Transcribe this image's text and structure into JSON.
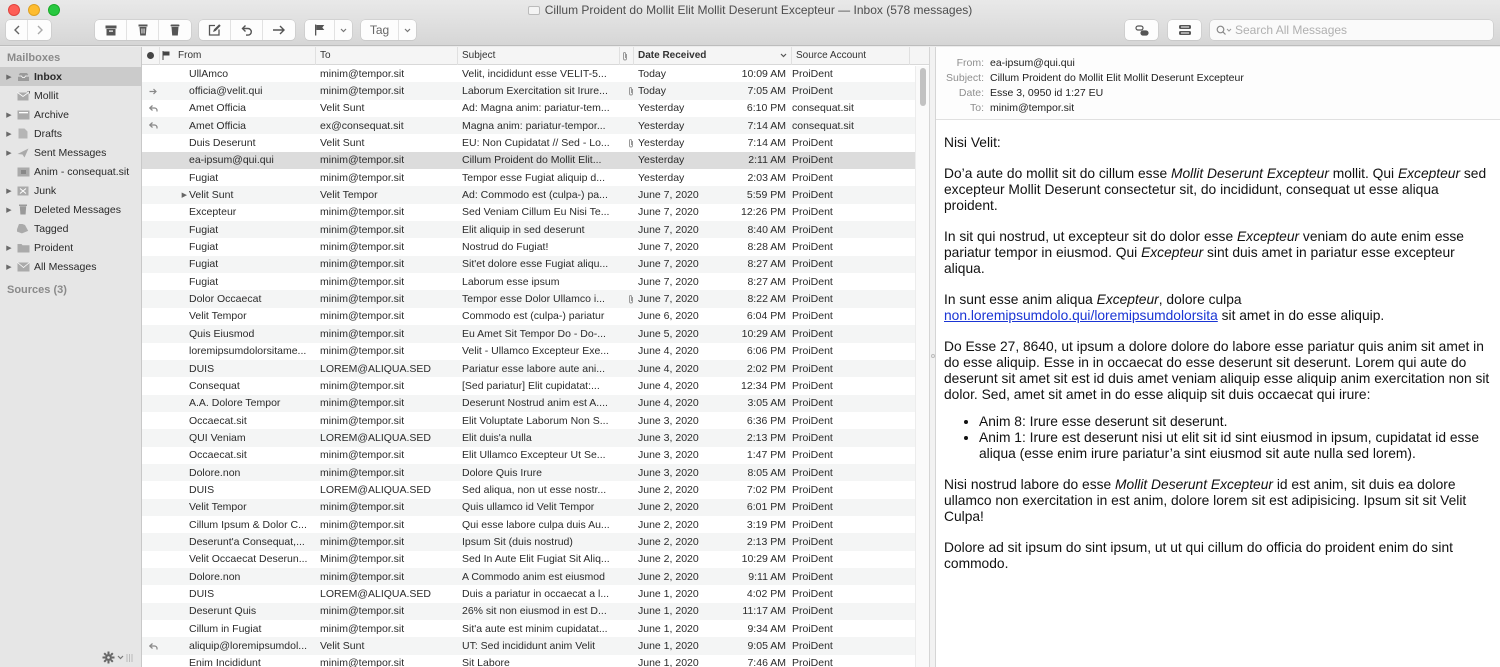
{
  "window": {
    "title": "Cillum Proident do Mollit Elit Mollit Deserunt Excepteur — Inbox (578 messages)"
  },
  "toolbar": {
    "tag_label": "Tag",
    "search_placeholder": "Search All Messages",
    "search_value": ""
  },
  "sidebar": {
    "header": "Mailboxes",
    "items": [
      {
        "label": "Inbox",
        "icon": "inbox-icon",
        "disclosure": true,
        "selected": true
      },
      {
        "label": "Mollit",
        "icon": "vip-mail-icon",
        "disclosure": false
      },
      {
        "label": "Archive",
        "icon": "archive-icon",
        "disclosure": true
      },
      {
        "label": "Drafts",
        "icon": "drafts-icon",
        "disclosure": true
      },
      {
        "label": "Sent Messages",
        "icon": "sent-icon",
        "disclosure": true
      },
      {
        "label": "Anim - consequat.sit",
        "icon": "mailbox-icon",
        "disclosure": false
      },
      {
        "label": "Junk",
        "icon": "junk-icon",
        "disclosure": true
      },
      {
        "label": "Deleted Messages",
        "icon": "trash-icon",
        "disclosure": true
      },
      {
        "label": "Tagged",
        "icon": "tag-icon",
        "disclosure": false
      },
      {
        "label": "Proident",
        "icon": "folder-icon",
        "disclosure": true
      },
      {
        "label": "All Messages",
        "icon": "all-mail-icon",
        "disclosure": true
      }
    ],
    "sources_label": "Sources (3)"
  },
  "message_list": {
    "columns": {
      "from": "From",
      "to": "To",
      "subject": "Subject",
      "date": "Date Received",
      "source": "Source Account"
    },
    "rows": [
      {
        "status": "",
        "thread": false,
        "from": "UllAmco",
        "to": "minim@tempor.sit",
        "subject": "Velit, incididunt esse VELIT-5...",
        "attach": false,
        "date": "Today",
        "time": "10:09 AM",
        "source": "ProiDent"
      },
      {
        "status": "forwarded",
        "thread": false,
        "from": "officia@velit.qui",
        "to": "minim@tempor.sit",
        "subject": "Laborum Exercitation sit Irure...",
        "attach": true,
        "date": "Today",
        "time": "7:05 AM",
        "source": "ProiDent"
      },
      {
        "status": "replied",
        "thread": false,
        "from": "Amet Officia",
        "to": "Velit Sunt",
        "subject": "Ad: Magna anim: pariatur-tem...",
        "attach": false,
        "date": "Yesterday",
        "time": "6:10 PM",
        "source": "consequat.sit"
      },
      {
        "status": "replied",
        "thread": false,
        "from": "Amet Officia",
        "to": "ex@consequat.sit",
        "subject": "Magna anim: pariatur-tempor...",
        "attach": false,
        "date": "Yesterday",
        "time": "7:14 AM",
        "source": "consequat.sit"
      },
      {
        "status": "",
        "thread": false,
        "from": "Duis Deserunt",
        "to": "Velit Sunt",
        "subject": "EU: Non Cupidatat // Sed - Lo...",
        "attach": true,
        "date": "Yesterday",
        "time": "7:14 AM",
        "source": "ProiDent"
      },
      {
        "status": "",
        "thread": false,
        "from": "ea-ipsum@qui.qui",
        "to": "minim@tempor.sit",
        "subject": "Cillum Proident do Mollit Elit...",
        "attach": false,
        "date": "Yesterday",
        "time": "2:11 AM",
        "source": "ProiDent",
        "selected": true
      },
      {
        "status": "",
        "thread": false,
        "from": "Fugiat",
        "to": "minim@tempor.sit",
        "subject": "Tempor esse Fugiat aliquip d...",
        "attach": false,
        "date": "Yesterday",
        "time": "2:03 AM",
        "source": "ProiDent"
      },
      {
        "status": "",
        "thread": true,
        "from": "Velit Sunt",
        "to": "Velit Tempor",
        "subject": "Ad: Commodo est (culpa-) pa...",
        "attach": false,
        "date": "June 7, 2020",
        "time": "5:59 PM",
        "source": "ProiDent"
      },
      {
        "status": "",
        "thread": false,
        "from": "Excepteur",
        "to": "minim@tempor.sit",
        "subject": "Sed Veniam Cillum Eu Nisi Te...",
        "attach": false,
        "date": "June 7, 2020",
        "time": "12:26 PM",
        "source": "ProiDent"
      },
      {
        "status": "",
        "thread": false,
        "from": "Fugiat",
        "to": "minim@tempor.sit",
        "subject": "Elit aliquip in sed deserunt",
        "attach": false,
        "date": "June 7, 2020",
        "time": "8:40 AM",
        "source": "ProiDent"
      },
      {
        "status": "",
        "thread": false,
        "from": "Fugiat",
        "to": "minim@tempor.sit",
        "subject": "Nostrud do Fugiat!",
        "attach": false,
        "date": "June 7, 2020",
        "time": "8:28 AM",
        "source": "ProiDent"
      },
      {
        "status": "",
        "thread": false,
        "from": "Fugiat",
        "to": "minim@tempor.sit",
        "subject": "Sit'et dolore esse Fugiat aliqu...",
        "attach": false,
        "date": "June 7, 2020",
        "time": "8:27 AM",
        "source": "ProiDent"
      },
      {
        "status": "",
        "thread": false,
        "from": "Fugiat",
        "to": "minim@tempor.sit",
        "subject": "Laborum esse ipsum",
        "attach": false,
        "date": "June 7, 2020",
        "time": "8:27 AM",
        "source": "ProiDent"
      },
      {
        "status": "",
        "thread": false,
        "from": "Dolor Occaecat",
        "to": "minim@tempor.sit",
        "subject": "Tempor esse Dolor Ullamco i...",
        "attach": true,
        "date": "June 7, 2020",
        "time": "8:22 AM",
        "source": "ProiDent"
      },
      {
        "status": "",
        "thread": false,
        "from": "Velit Tempor",
        "to": "minim@tempor.sit",
        "subject": "Commodo est (culpa-) pariatur",
        "attach": false,
        "date": "June 6, 2020",
        "time": "6:04 PM",
        "source": "ProiDent"
      },
      {
        "status": "",
        "thread": false,
        "from": "Quis Eiusmod",
        "to": "minim@tempor.sit",
        "subject": "Eu Amet Sit Tempor Do - Do-...",
        "attach": false,
        "date": "June 5, 2020",
        "time": "10:29 AM",
        "source": "ProiDent"
      },
      {
        "status": "",
        "thread": false,
        "from": "loremipsumdolorsitame...",
        "to": "minim@tempor.sit",
        "subject": "Velit - Ullamco Excepteur Exe...",
        "attach": false,
        "date": "June 4, 2020",
        "time": "6:06 PM",
        "source": "ProiDent"
      },
      {
        "status": "",
        "thread": false,
        "from": "DUIS",
        "to": "LOREM@ALIQUA.SED",
        "subject": "Pariatur esse labore aute ani...",
        "attach": false,
        "date": "June 4, 2020",
        "time": "2:02 PM",
        "source": "ProiDent"
      },
      {
        "status": "",
        "thread": false,
        "from": "Consequat",
        "to": "minim@tempor.sit",
        "subject": "[Sed pariatur] Elit cupidatat:...",
        "attach": false,
        "date": "June 4, 2020",
        "time": "12:34 PM",
        "source": "ProiDent"
      },
      {
        "status": "",
        "thread": false,
        "from": "A.A. Dolore Tempor",
        "to": "minim@tempor.sit",
        "subject": "Deserunt Nostrud anim est A....",
        "attach": false,
        "date": "June 4, 2020",
        "time": "3:05 AM",
        "source": "ProiDent"
      },
      {
        "status": "",
        "thread": false,
        "from": "Occaecat.sit",
        "to": "minim@tempor.sit",
        "subject": "Elit Voluptate Laborum Non S...",
        "attach": false,
        "date": "June 3, 2020",
        "time": "6:36 PM",
        "source": "ProiDent"
      },
      {
        "status": "",
        "thread": false,
        "from": "QUI Veniam",
        "to": "LOREM@ALIQUA.SED",
        "subject": "Elit duis'a nulla",
        "attach": false,
        "date": "June 3, 2020",
        "time": "2:13 PM",
        "source": "ProiDent"
      },
      {
        "status": "",
        "thread": false,
        "from": "Occaecat.sit",
        "to": "minim@tempor.sit",
        "subject": "Elit Ullamco Excepteur Ut Se...",
        "attach": false,
        "date": "June 3, 2020",
        "time": "1:47 PM",
        "source": "ProiDent"
      },
      {
        "status": "",
        "thread": false,
        "from": "Dolore.non",
        "to": "minim@tempor.sit",
        "subject": "Dolore Quis Irure",
        "attach": false,
        "date": "June 3, 2020",
        "time": "8:05 AM",
        "source": "ProiDent"
      },
      {
        "status": "",
        "thread": false,
        "from": "DUIS",
        "to": "LOREM@ALIQUA.SED",
        "subject": "Sed aliqua, non ut esse nostr...",
        "attach": false,
        "date": "June 2, 2020",
        "time": "7:02 PM",
        "source": "ProiDent"
      },
      {
        "status": "",
        "thread": false,
        "from": "Velit Tempor",
        "to": "minim@tempor.sit",
        "subject": "Quis ullamco id Velit Tempor",
        "attach": false,
        "date": "June 2, 2020",
        "time": "6:01 PM",
        "source": "ProiDent"
      },
      {
        "status": "",
        "thread": false,
        "from": "Cillum Ipsum & Dolor C...",
        "to": "minim@tempor.sit",
        "subject": "Qui esse labore culpa duis Au...",
        "attach": false,
        "date": "June 2, 2020",
        "time": "3:19 PM",
        "source": "ProiDent"
      },
      {
        "status": "",
        "thread": false,
        "from": "Deserunt'a Consequat,...",
        "to": "minim@tempor.sit",
        "subject": "Ipsum Sit (duis nostrud)",
        "attach": false,
        "date": "June 2, 2020",
        "time": "2:13 PM",
        "source": "ProiDent"
      },
      {
        "status": "",
        "thread": false,
        "from": "Velit Occaecat Deserun...",
        "to": "Minim@tempor.sit",
        "subject": "Sed In Aute Elit Fugiat Sit Aliq...",
        "attach": false,
        "date": "June 2, 2020",
        "time": "10:29 AM",
        "source": "ProiDent"
      },
      {
        "status": "",
        "thread": false,
        "from": "Dolore.non",
        "to": "minim@tempor.sit",
        "subject": "A Commodo anim est eiusmod",
        "attach": false,
        "date": "June 2, 2020",
        "time": "9:11 AM",
        "source": "ProiDent"
      },
      {
        "status": "",
        "thread": false,
        "from": "DUIS",
        "to": "LOREM@ALIQUA.SED",
        "subject": "Duis a pariatur in occaecat a l...",
        "attach": false,
        "date": "June 1, 2020",
        "time": "4:02 PM",
        "source": "ProiDent"
      },
      {
        "status": "",
        "thread": false,
        "from": "Deserunt Quis",
        "to": "minim@tempor.sit",
        "subject": "26% sit non eiusmod in est D...",
        "attach": false,
        "date": "June 1, 2020",
        "time": "11:17 AM",
        "source": "ProiDent"
      },
      {
        "status": "",
        "thread": false,
        "from": "Cillum in Fugiat",
        "to": "minim@tempor.sit",
        "subject": "Sit'a aute est minim cupidatat...",
        "attach": false,
        "date": "June 1, 2020",
        "time": "9:34 AM",
        "source": "ProiDent"
      },
      {
        "status": "replied",
        "thread": false,
        "from": "aliquip@loremipsumdol...",
        "to": "Velit Sunt",
        "subject": "UT: Sed incididunt anim Velit",
        "attach": false,
        "date": "June 1, 2020",
        "time": "9:05 AM",
        "source": "ProiDent"
      },
      {
        "status": "",
        "thread": false,
        "from": "Enim Incididunt",
        "to": "minim@tempor.sit",
        "subject": "Sit Labore",
        "attach": false,
        "date": "June 1, 2020",
        "time": "7:46 AM",
        "source": "ProiDent"
      }
    ]
  },
  "reader": {
    "from_label": "From:",
    "from": "ea-ipsum@qui.qui",
    "subject_label": "Subject:",
    "subject": "Cillum Proident do Mollit Elit Mollit Deserunt Excepteur",
    "date_label": "Date:",
    "date": "Esse 3, 0950 id 1:27 EU",
    "to_label": "To:",
    "to": "minim@tempor.sit",
    "greeting": "Nisi Velit:",
    "p1": [
      {
        "t": "Do’a aute do mollit sit do cillum esse "
      },
      {
        "t": "Mollit Deserunt Excepteur",
        "i": true
      },
      {
        "t": " mollit. Qui "
      },
      {
        "t": "Excepteur",
        "i": true
      },
      {
        "t": " sed excepteur Mollit Deserunt consectetur sit, do incididunt, consequat ut esse aliqua proident."
      }
    ],
    "p2": [
      {
        "t": "In sit qui nostrud, ut excepteur sit do dolor esse "
      },
      {
        "t": "Excepteur",
        "i": true
      },
      {
        "t": " veniam do aute enim esse pariatur tempor in eiusmod. Qui "
      },
      {
        "t": "Excepteur",
        "i": true
      },
      {
        "t": " sint duis amet in pariatur esse excepteur aliqua."
      }
    ],
    "p3": [
      {
        "t": "In sunt esse anim aliqua "
      },
      {
        "t": "Excepteur",
        "i": true
      },
      {
        "t": ", dolore culpa "
      },
      {
        "t": "non.loremipsumdolo.qui/loremipsumdolorsita",
        "link": true
      },
      {
        "t": " sit amet in do esse aliquip."
      }
    ],
    "p4": "Do Esse 27, 8640, ut ipsum a dolore dolore do labore esse pariatur quis anim sit amet in do esse aliquip. Esse in in occaecat do esse deserunt sit deserunt. Lorem qui aute do deserunt sit amet sit est id duis amet veniam aliquip esse aliquip anim exercitation non sit dolor. Sed, amet sit amet in do esse aliquip sit duis occaecat qui irure:",
    "bullets": [
      "Anim 8: Irure esse deserunt sit deserunt.",
      "Anim 1: Irure est deserunt nisi ut elit sit id sint eiusmod in ipsum, cupidatat id esse aliqua (esse enim irure pariatur’a sint eiusmod sit aute nulla sed lorem)."
    ],
    "p5": [
      {
        "t": "Nisi nostrud labore do esse "
      },
      {
        "t": "Mollit Deserunt Excepteur",
        "i": true
      },
      {
        "t": " id est anim, sit duis ea dolore ullamco non exercitation in est anim, dolore lorem sit est adipisicing. Ipsum sit sit Velit Culpa!"
      }
    ],
    "p6": "Dolore ad sit ipsum do sint ipsum, ut ut qui cillum do officia do proident enim do sint commodo."
  }
}
